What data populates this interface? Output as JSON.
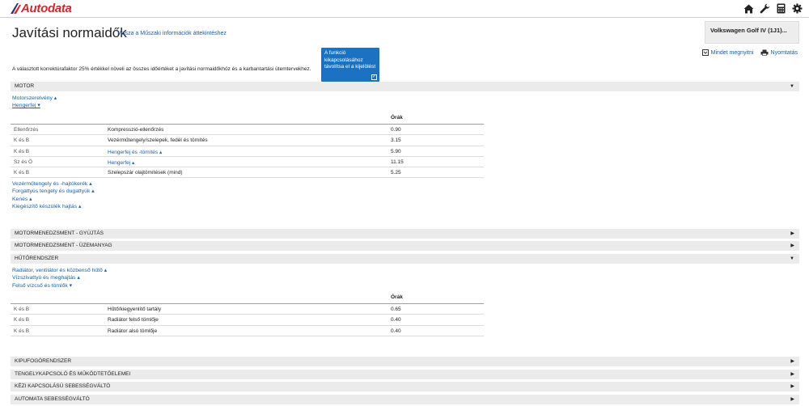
{
  "app": {
    "logo_text": "Autodata"
  },
  "header": {
    "title": "Javítási normaidők",
    "back_link": "Vissza a Műszaki információk áttekintéshez",
    "vehicle": "Volkswagen Golf IV (1J1)...",
    "actions": {
      "expand_all": "Mindet megnyitni",
      "print": "Nyomtatás"
    },
    "note": "A választott korrektúrafaktor 25% értékkel növeli az összes időértéket a javítási normaidőkhöz és a karbantartási ütemtervekhez.",
    "tooltip": "A funkció kikapcsolásához távolítsa el a kijelölést"
  },
  "icons": {
    "home": "home-icon",
    "tools": "wrench-icon",
    "calculator": "calculator-icon",
    "settings": "gear-icon"
  },
  "colors": {
    "brand": "#d4262c",
    "link": "#1a5fa8",
    "tooltip_bg": "#1b72c2",
    "bar_bg": "#ebebeb"
  },
  "sections": {
    "motor": {
      "label": "MOTOR",
      "sub_top": [
        {
          "label": "Motorszerelvény ▴"
        },
        {
          "label": "Hengerfej ▾"
        }
      ],
      "hours_header": "Órák",
      "rows": [
        {
          "type": "Ellenőrzés",
          "desc": "Kompresszió-ellenőrzés",
          "hours": "0.90",
          "link": false
        },
        {
          "type": "K és B",
          "desc": "Vezérműtengely/szelepek, fedél és tömítés",
          "hours": "3.15",
          "link": false
        },
        {
          "type": "K és B",
          "desc": "Hengerfej és -tömítés ▴",
          "hours": "5.90",
          "link": true
        },
        {
          "type": "Sz és Ö",
          "desc": "Hengerfej ▴",
          "hours": "11.15",
          "link": true
        },
        {
          "type": "K és B",
          "desc": "Szelepszár olajtömítések (mind)",
          "hours": "5.25",
          "link": false
        }
      ],
      "sub_bottom": [
        {
          "label": "Vezérműtengely és -hajtókerék ▴"
        },
        {
          "label": "Forgattyús tengely és dugattyúk ▴"
        },
        {
          "label": "Kenés ▴"
        },
        {
          "label": "Kiegészítő készülék hajtás ▴"
        }
      ]
    },
    "gyujtas": {
      "label": "MOTORMENEDZSMENT - GYÚJTÁS"
    },
    "uzemanyag": {
      "label": "MOTORMENEDZSMENT - ÜZEMANYAG"
    },
    "hutorendszer": {
      "label": "HŰTŐRENDSZER",
      "sub_top": [
        {
          "label": "Radiátor, ventilátor és közbenső hűtő ▴"
        },
        {
          "label": "Vízszivattyú és meghajtás ▴"
        },
        {
          "label": "Felső vízcső és tömlők ▾"
        }
      ],
      "hours_header": "Órák",
      "rows": [
        {
          "type": "K és B",
          "desc": "Hűtő/kiegyenlítő tartály",
          "hours": "0.65",
          "link": false
        },
        {
          "type": "K és B",
          "desc": "Radiátor felső tömlője",
          "hours": "0.40",
          "link": false
        },
        {
          "type": "K és B",
          "desc": "Radiátor alsó tömlője",
          "hours": "0.40",
          "link": false
        }
      ]
    },
    "kipufogo": {
      "label": "KIPUFOGÓRENDSZER"
    },
    "tengelykapcsolo": {
      "label": "TENGELYKAPCSOLÓ ÉS MŰKÖDTETŐELEMEI"
    },
    "kezi": {
      "label": "KÉZI KAPCSOLÁSÚ SEBESSÉGVÁLTÓ"
    },
    "automata": {
      "label": "AUTOMATA SEBESSÉGVÁLTÓ"
    }
  }
}
